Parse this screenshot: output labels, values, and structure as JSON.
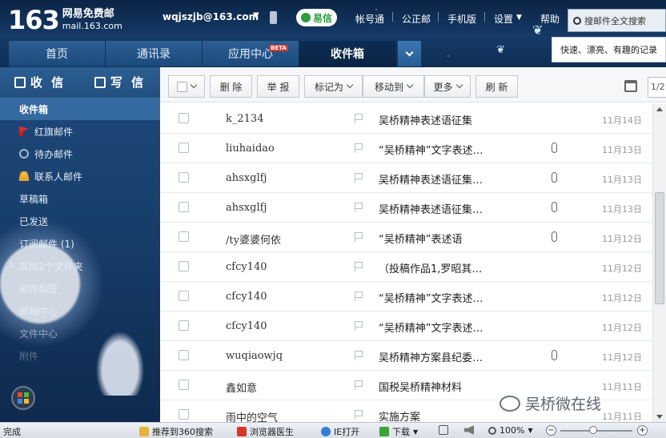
{
  "brand": {
    "number": "163",
    "name": "网易免费邮",
    "domain": "mail.163.com"
  },
  "header": {
    "user_email": "wqjszjb@163.com",
    "yixin_label": "易信",
    "links": [
      "帐号通",
      "公正邮",
      "手机版",
      "设置",
      "帮助"
    ],
    "search_label": "搜邮件全文搜索",
    "tip_text": "快速、漂亮、有趣的记录"
  },
  "nav": {
    "tabs": [
      "首页",
      "通讯录",
      "应用中心",
      "收件箱"
    ],
    "beta_badge": "BETA"
  },
  "sidebar": {
    "receive_label": "收 信",
    "compose_label": "写 信",
    "folders": [
      {
        "label": "收件箱"
      },
      {
        "label": "红旗邮件"
      },
      {
        "label": "待办邮件"
      },
      {
        "label": "联系人邮件"
      },
      {
        "label": "草稿箱"
      },
      {
        "label": "已发送"
      },
      {
        "label": "订阅邮件 (1)"
      },
      {
        "label": "其他2个文件夹"
      },
      {
        "label": "邮件标签"
      },
      {
        "label": "邮箱中心"
      },
      {
        "label": "文件中心"
      },
      {
        "label": "附件"
      }
    ]
  },
  "toolbar": {
    "delete_label": "删 除",
    "report_label": "举 报",
    "mark_label": "标记为",
    "move_label": "移动到",
    "more_label": "更多",
    "refresh_label": "刷 新",
    "page_text": "1/2"
  },
  "messages": [
    {
      "sender": "k_2134",
      "subject": "吴桥精神表述语征集",
      "attachment": false,
      "date": "11月14日"
    },
    {
      "sender": "liuhaidao",
      "subject": "“吴桥精神”文字表述…",
      "attachment": true,
      "date": "11月13日"
    },
    {
      "sender": "ahsxglfj",
      "subject": "吴桥精神表述语征集…",
      "attachment": true,
      "date": "11月13日"
    },
    {
      "sender": "ahsxglfj",
      "subject": "吴桥精神表述语征集…",
      "attachment": true,
      "date": "11月13日"
    },
    {
      "sender": "/ty婆婆何依",
      "subject": "“吴桥精神”表述语",
      "attachment": true,
      "date": "11月12日"
    },
    {
      "sender": "cfcy140",
      "subject": "（投稿作品1,罗昭其…",
      "attachment": false,
      "date": "11月12日"
    },
    {
      "sender": "cfcy140",
      "subject": "“吴桥精神”文字表述…",
      "attachment": false,
      "date": "11月12日"
    },
    {
      "sender": "cfcy140",
      "subject": "“吴桥精神”文字表述…",
      "attachment": false,
      "date": "11月12日"
    },
    {
      "sender": "wuqiaowjq",
      "subject": "吴桥精神方案县纪委…",
      "attachment": true,
      "date": "11月12日"
    },
    {
      "sender": "鑫如意",
      "subject": "国税吴桥精神材料",
      "attachment": false,
      "date": "11月11日"
    },
    {
      "sender": "雨中的空气",
      "subject": "实施方案",
      "attachment": false,
      "date": "11月11日"
    }
  ],
  "watermark": {
    "text": "吴桥微在线"
  },
  "statusbar": {
    "status": "完成",
    "recommend": "推荐到360搜索",
    "doctor": "浏览器医生",
    "ie_open": "IE打开",
    "download": "下载",
    "zoom": "100%"
  }
}
